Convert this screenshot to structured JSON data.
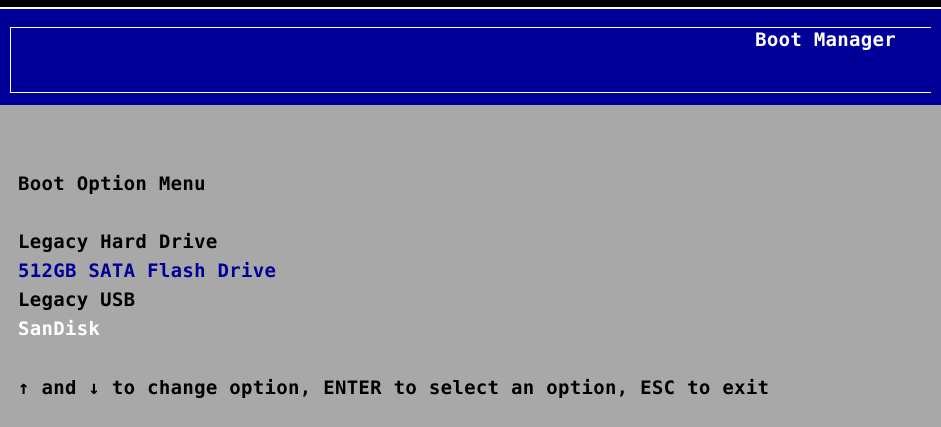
{
  "header": {
    "title": "Boot Manager"
  },
  "menu": {
    "heading": "Boot Option Menu",
    "groups": [
      {
        "label": "Legacy Hard Drive",
        "items": [
          {
            "label": "512GB SATA Flash Drive"
          }
        ]
      },
      {
        "label": "Legacy USB",
        "items": [
          {
            "label": "SanDisk"
          }
        ]
      }
    ]
  },
  "footer": {
    "help": "↑ and ↓ to change option, ENTER to select an option, ESC to exit"
  },
  "colors": {
    "header_bg": "#000098",
    "body_bg": "#a8a8a8",
    "text": "#000000",
    "selected_text": "#000098",
    "highlight_text": "#ffffff"
  }
}
